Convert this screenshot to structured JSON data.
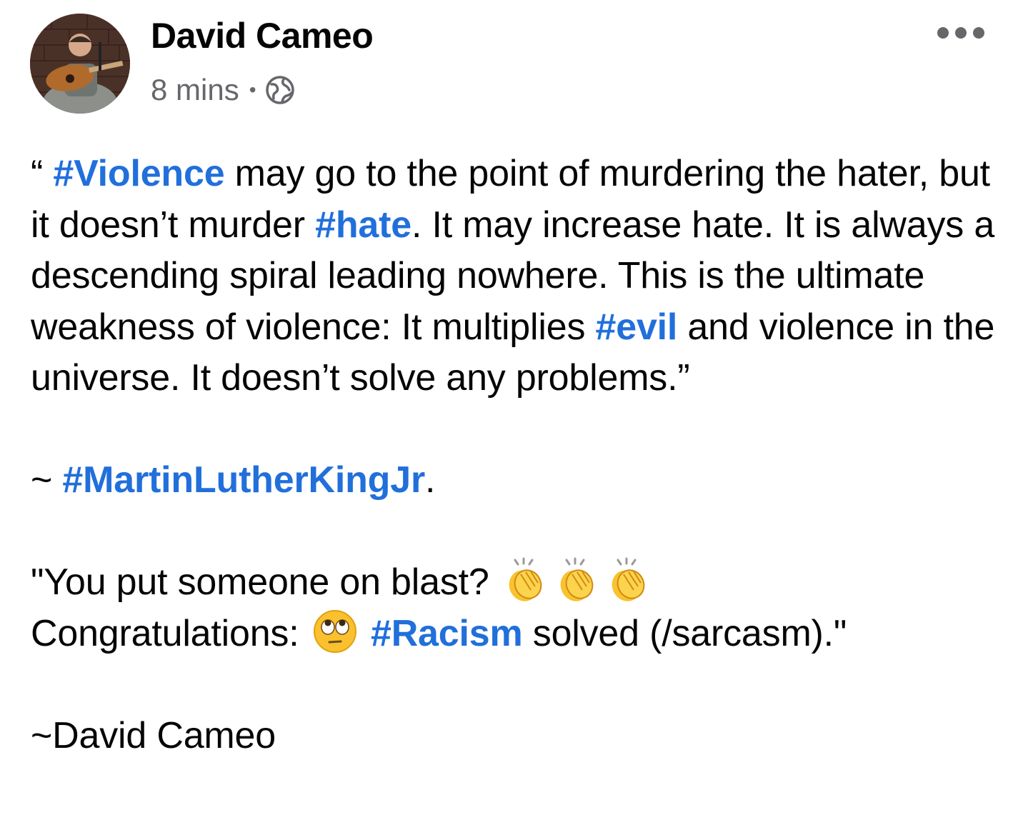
{
  "post": {
    "author": "David Cameo",
    "time": "8 mins",
    "separator": "•",
    "audience_icon": "globe-icon",
    "more_icon": "more-options-icon",
    "hashtag_color": "#216fdb",
    "meta_color": "#65676b"
  },
  "quote": {
    "open": "“ ",
    "tag_violence": "#Violence",
    "t1": " may go to the point of murdering the hater, but it doesn’t murder ",
    "tag_hate": "#hate",
    "t2": ". It may increase hate. It is always a descending spiral leading nowhere. This is the ultimate weakness of violence: It multiplies ",
    "tag_evil": "#evil",
    "t3": " and violence in the universe. It doesn’t solve any problems.”"
  },
  "attribution": {
    "prefix": "~ ",
    "tag": "#MartinLutherKingJr",
    "suffix": "."
  },
  "comment": {
    "line1": "\"You put someone on blast? ",
    "clap_emoji": "clapping-hands-emoji",
    "line2_prefix": "Congratulations: ",
    "eye_roll_emoji": "face-with-rolling-eyes-emoji",
    "tag_racism": "#Racism",
    "line2_suffix": " solved (/sarcasm).\""
  },
  "signature": "~David Cameo"
}
